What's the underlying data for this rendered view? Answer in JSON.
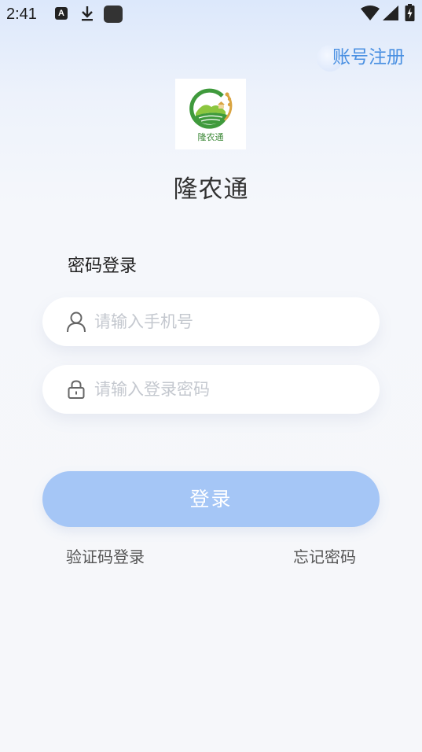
{
  "status_bar": {
    "time": "2:41",
    "notification_a": "A",
    "icons": [
      "notification-a-icon",
      "download-icon",
      "app-square-icon",
      "wifi-icon",
      "cell-signal-icon",
      "battery-charging-icon"
    ]
  },
  "header": {
    "register_label": "账号注册"
  },
  "logo": {
    "caption": "隆农通",
    "colors": {
      "green": "#3f9a3c",
      "light_green": "#8cc63f",
      "wheat": "#d9a441"
    }
  },
  "app_name": "隆农通",
  "form": {
    "title": "密码登录",
    "phone": {
      "value": "",
      "placeholder": "请输入手机号"
    },
    "password": {
      "value": "",
      "placeholder": "请输入登录密码"
    },
    "login_label": "登录",
    "sms_login_label": "验证码登录",
    "forgot_password_label": "忘记密码"
  },
  "colors": {
    "accent": "#4a90e2",
    "button_bg": "#a5c6f6",
    "placeholder": "#c4c8cf"
  }
}
